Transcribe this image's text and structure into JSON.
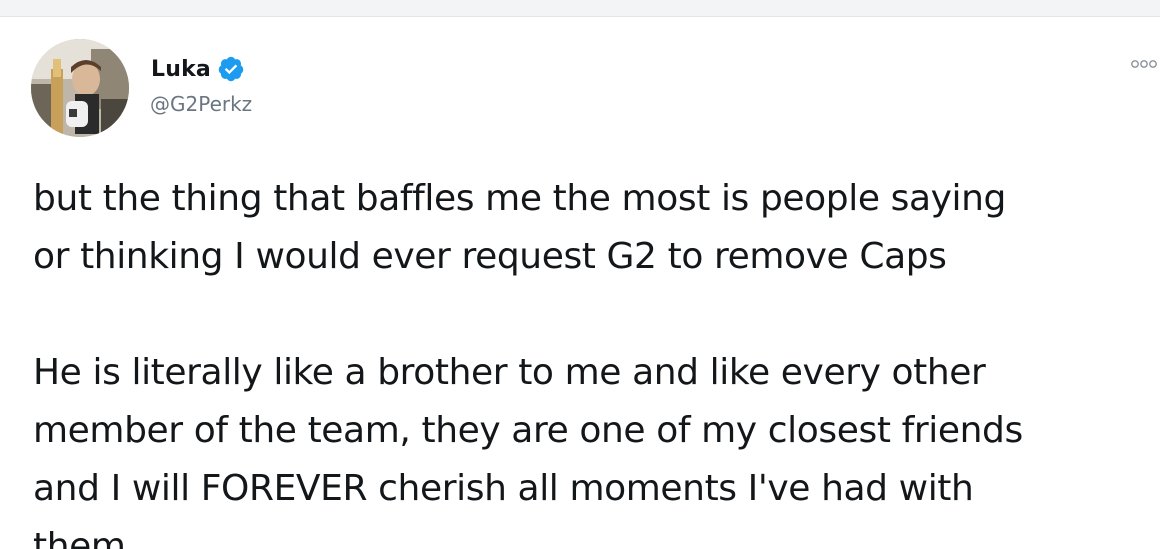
{
  "tweet": {
    "author": {
      "display_name": "Luka",
      "handle": "@G2Perkz",
      "verified_icon": "verified-badge-icon",
      "avatar_icon": "avatar-photo"
    },
    "more_icon": "more-options-icon",
    "text_lines_paragraph_1": [
      "but the thing that baffles me the most is people saying",
      "or thinking I would ever request G2 to remove Caps"
    ],
    "text_lines_paragraph_2": [
      "He is literally like a brother to me and like every other",
      "member of the team, they are one of my closest friends",
      "and I will FOREVER cherish all moments I've had with",
      "them"
    ]
  },
  "colors": {
    "verified_blue": "#1d9bf0",
    "text": "#14171a",
    "handle_gray": "#6b7680"
  }
}
